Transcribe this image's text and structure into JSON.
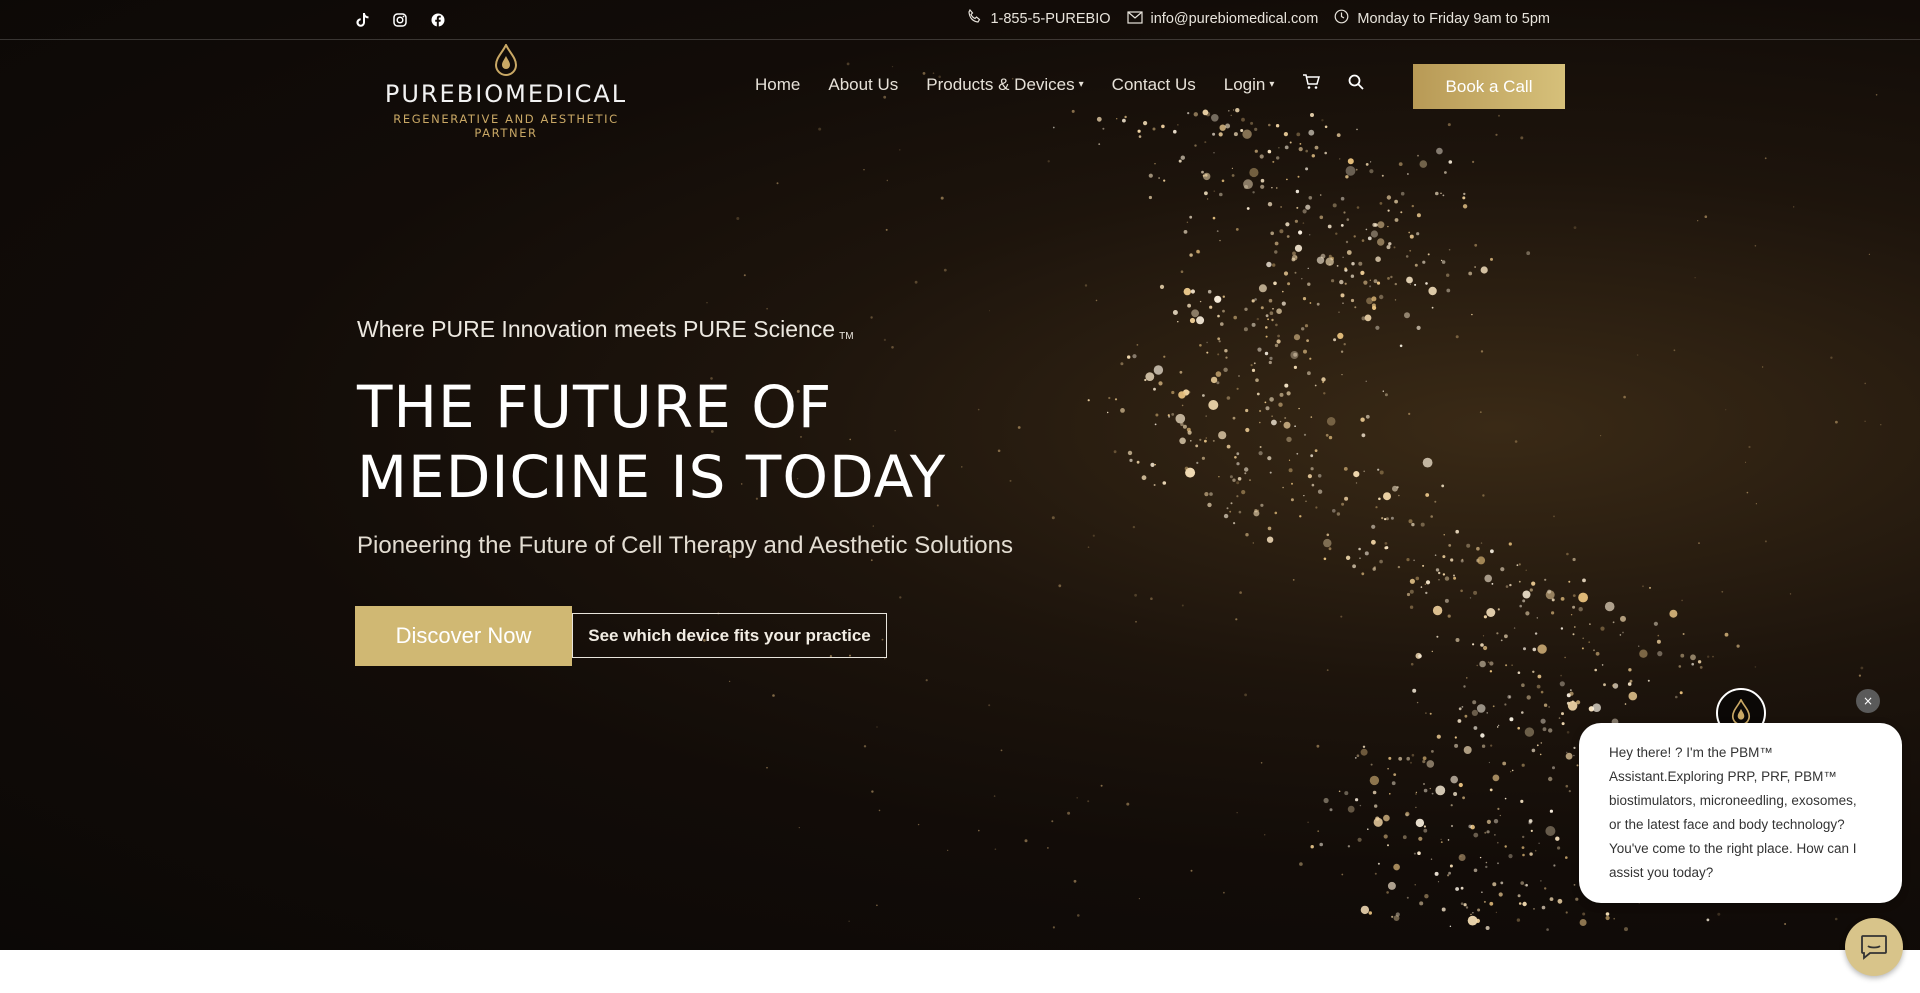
{
  "social": {
    "tiktok_icon": "tiktok-icon",
    "instagram_icon": "instagram-icon",
    "facebook_icon": "facebook-icon"
  },
  "contact": {
    "phone": "1-855-5-PUREBIO",
    "email": "info@purebiomedical.com",
    "hours": "Monday to Friday 9am to 5pm"
  },
  "logo": {
    "wordmark": "PUREBIOMEDICAL",
    "tagline": "REGENERATIVE AND AESTHETIC PARTNER"
  },
  "nav": {
    "home": "Home",
    "about": "About Us",
    "products": "Products & Devices",
    "contact": "Contact Us",
    "login": "Login",
    "book_call": "Book a Call"
  },
  "hero": {
    "tagline": "Where PURE Innovation meets PURE Science",
    "tagline_mark": "TM",
    "headline_line1": "THE FUTURE OF",
    "headline_line2": "MEDICINE IS TODAY",
    "subhead": "Pioneering the Future of Cell Therapy and Aesthetic Solutions",
    "discover_button": "Discover Now",
    "device_button": "See which device fits your practice"
  },
  "chat": {
    "message": "Hey there! ? I'm the PBM™ Assistant.Exploring PRP, PRF, PBM™ biostimulators, microneedling, exosomes, or the latest face and body technology? You've come to the right place. How can I assist you today?",
    "close_label": "×"
  },
  "colors": {
    "gold": "#d0b873",
    "gold_dark": "#b89a56",
    "background_dark": "#120c08"
  }
}
